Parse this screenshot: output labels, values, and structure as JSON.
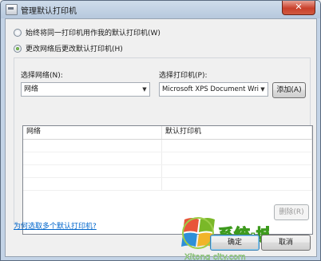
{
  "window": {
    "title": "管理默认打印机",
    "close_glyph": "✕"
  },
  "options": [
    {
      "label": "始终将同一打印机用作我的默认打印机(W)",
      "checked": false
    },
    {
      "label": "更改网络后更改默认打印机(H)",
      "checked": true
    }
  ],
  "network_select": {
    "label": "选择网络(N):",
    "value": "网络"
  },
  "printer_select": {
    "label": "选择打印机(P):",
    "value": "Microsoft XPS Document Wri"
  },
  "add_button": "添加(A)",
  "table": {
    "columns": [
      "网络",
      "默认打印机"
    ],
    "rows": []
  },
  "remove_button": "删除(R)",
  "help_link": "为何选取多个默认打印机?",
  "ok_button": "确定",
  "cancel_button": "取消",
  "watermark": {
    "brand": "系统城",
    "domain": "Xitong city.com"
  },
  "colors": {
    "accent_green": "#3d9a1d",
    "link_blue": "#0066cc"
  }
}
